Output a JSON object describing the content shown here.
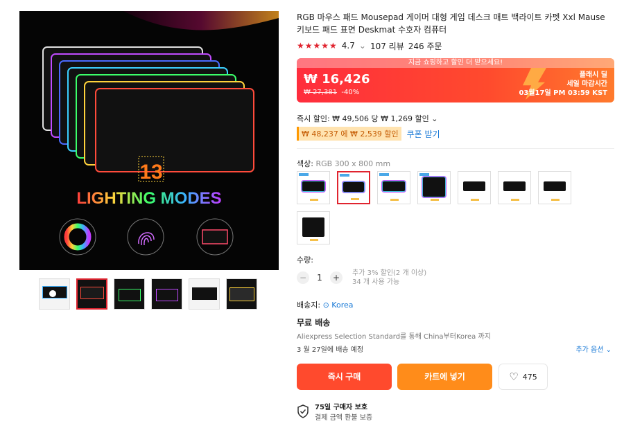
{
  "product": {
    "title": "RGB 마우스 패드 Mousepad 게이머 대형 게임 데스크 매트 백라이트 카펫 Xxl Mause 키보드 패드 표면 Deskmat 수호자 컴퓨터",
    "rating": "4.7",
    "rating_chevron": "⌄",
    "reviews": "107 리뷰",
    "orders": "246 주문",
    "stars": "★★★★★"
  },
  "hero": {
    "big_number": "13",
    "headline": "LIGHTING MODES"
  },
  "price": {
    "banner_hint": "지금 쇼핑하고 할인 더 받으세요!",
    "current": "₩ 16,426",
    "original": "₩ 27,381",
    "discount": "-40%",
    "flash_label": "플래시 딜",
    "flash_end": "세일 마감시간",
    "flash_time": "03월17일 PM 03:59 KST"
  },
  "instant_discount": "즉시 할인: ₩ 49,506 당 ₩ 1,269 할인 ⌄",
  "coupon": {
    "badge": "₩ 48,237 에 ₩ 2,539 할인",
    "link": "쿠폰 받기"
  },
  "color": {
    "label": "색상:",
    "value": "RGB 300 x 800 mm"
  },
  "quantity": {
    "label": "수량:",
    "minus": "−",
    "value": "1",
    "plus": "+",
    "note1": "추가 3% 할인(2 개 이상)",
    "note2": "34 개 사용 가능"
  },
  "shipping": {
    "to_label": "배송지:",
    "location_icon": "📍",
    "location": "Korea",
    "free": "무료 배송",
    "desc": "Aliexpress Selection Standard를 통해 China부터Korea 까지",
    "date": "3 월 27일에 배송 예정",
    "more": "추가 옵션 ⌄"
  },
  "actions": {
    "buy_now": "즉시 구매",
    "add_to_cart": "카트에 넣기",
    "wishlist_count": "475",
    "heart": "♡"
  },
  "protection": {
    "title": "75일 구매자 보호",
    "subtitle": "결제 금액 환불 보증"
  }
}
